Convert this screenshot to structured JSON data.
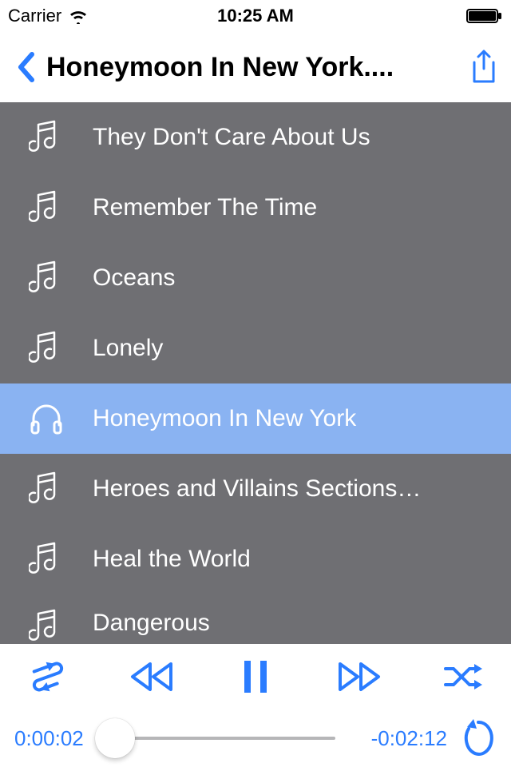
{
  "status": {
    "carrier": "Carrier",
    "time": "10:25 AM"
  },
  "nav": {
    "title": "Honeymoon In New York...."
  },
  "tracks": [
    {
      "label": "They Don't Care About Us",
      "selected": false
    },
    {
      "label": "Remember The Time",
      "selected": false
    },
    {
      "label": "Oceans",
      "selected": false
    },
    {
      "label": "Lonely",
      "selected": false
    },
    {
      "label": "Honeymoon In New York",
      "selected": true
    },
    {
      "label": "Heroes and Villains Sections…",
      "selected": false
    },
    {
      "label": "Heal the World",
      "selected": false
    },
    {
      "label": "Dangerous",
      "selected": false
    }
  ],
  "player": {
    "elapsed": "0:00:02",
    "remaining": "-0:02:12",
    "progress_pct": 2
  },
  "colors": {
    "accent": "#2a7cff",
    "list_bg": "#6f6f73",
    "selected_bg": "#8ab3f2"
  }
}
